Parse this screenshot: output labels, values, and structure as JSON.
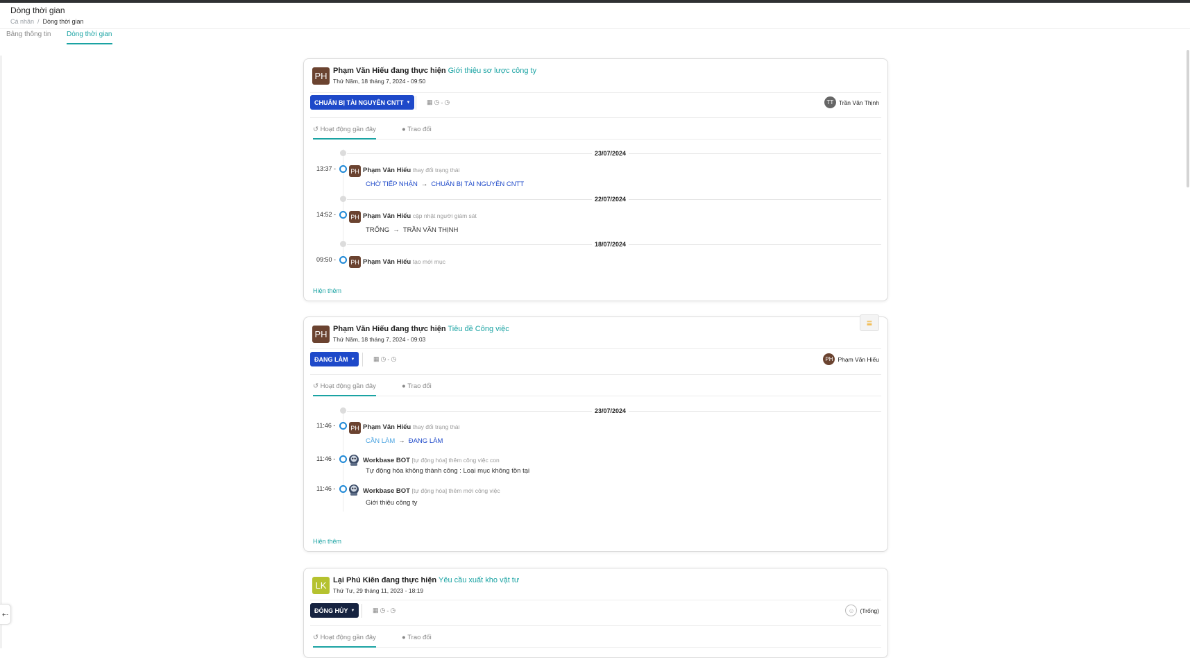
{
  "page": {
    "title": "Dòng thời gian",
    "breadcrumb": [
      "Cá nhân",
      "Dòng thời gian"
    ],
    "tabs": [
      "Bảng thông tin",
      "Dòng thời gian"
    ]
  },
  "cards": [
    {
      "avatar": "PH",
      "actor": "Phạm Văn Hiếu",
      "verb": "đang thực hiện",
      "task": "Giới thiệu sơ lược công ty",
      "date": "Thứ Năm, 18 tháng 7, 2024 - 09:50",
      "status": "CHUẨN BỊ TÀI NGUYÊN CNTT",
      "assignee_initials": "TT",
      "assignee": "Trần Văn Thịnh",
      "subtabs": [
        "Hoạt động gần đây",
        "Trao đổi"
      ],
      "activity": [
        {
          "day": "23/07/2024",
          "time": "13:37 -",
          "actor": "Phạm Văn Hiếu",
          "verb": "thay đổi trạng thái",
          "from": "CHỜ TIẾP NHẬN",
          "to": "CHUẨN BỊ TÀI NGUYÊN CNTT"
        },
        {
          "day": "22/07/2024",
          "time": "14:52 -",
          "actor": "Phạm Văn Hiếu",
          "verb": "cập nhật người giám sát",
          "from": "TRỐNG",
          "to": "TRẦN VĂN THỊNH"
        },
        {
          "day": "18/07/2024",
          "time": "09:50 -",
          "actor": "Phạm Văn Hiếu",
          "verb": "tạo mới mục"
        }
      ],
      "more": "Hiện thêm"
    },
    {
      "avatar": "PH",
      "actor": "Phạm Văn Hiếu",
      "verb": "đang thực hiện",
      "task": "Tiêu đề Công việc",
      "date": "Thứ Năm, 18 tháng 7, 2024 - 09:03",
      "status": "ĐANG LÀM",
      "assignee_initials": "PH",
      "assignee": "Phạm Văn Hiếu",
      "subtabs": [
        "Hoạt động gần đây",
        "Trao đổi"
      ],
      "day": "23/07/2024",
      "activity": [
        {
          "time": "11:46 -",
          "actor": "Phạm Văn Hiếu",
          "verb": "thay đổi trạng thái",
          "from": "CẦN LÀM",
          "to": "ĐANG LÀM"
        },
        {
          "time": "11:46 -",
          "actor": "Workbase BOT",
          "verb": "[tự động hóa] thêm công việc con",
          "note": "Tự động hóa không thành công : Loại mục không tồn tại"
        },
        {
          "time": "11:46 -",
          "actor": "Workbase BOT",
          "verb": "[tự động hóa] thêm mới công việc",
          "note": "Giới thiệu công ty"
        }
      ],
      "more": "Hiện thêm"
    },
    {
      "avatar": "LK",
      "actor": "Lại Phú Kiên",
      "verb": "đang thực hiện",
      "task": "Yêu cầu xuất kho vật tư",
      "date": "Thứ Tư, 29 tháng 11, 2023 - 18:19",
      "status": "ĐÓNG HỦY",
      "assignee": "(Trống)",
      "subtabs": [
        "Hoạt động gần đây",
        "Trao đổi"
      ]
    }
  ],
  "icons": {
    "calendar": "calendar-icon",
    "clock": "clock-icon",
    "history": "history-icon",
    "chat": "chat-icon",
    "menu": "menu-icon",
    "back": "arrow-left-icon"
  },
  "colors": {
    "accent": "#1aa3a3",
    "status_blue": "#1e49c9",
    "status_navy": "#162340",
    "avatar_brown": "#6b4330",
    "avatar_olive": "#b5c22f"
  }
}
